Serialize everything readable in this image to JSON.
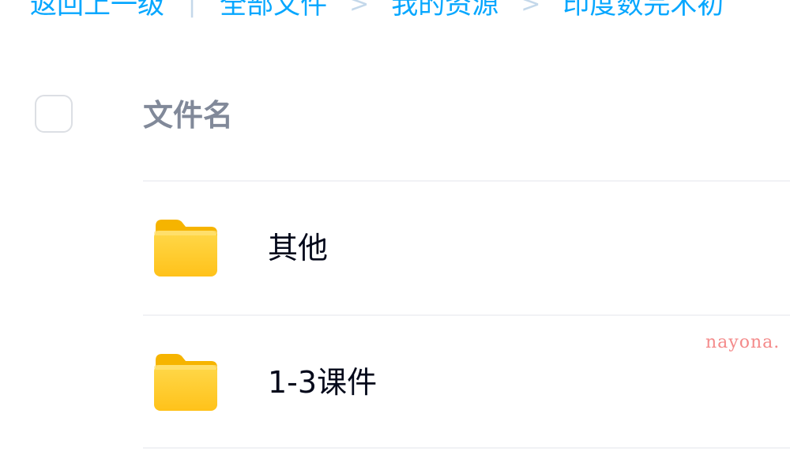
{
  "breadcrumb": {
    "back_label": "返回上一级",
    "divider": "|",
    "separator": ">",
    "items": [
      "全部文件",
      "我的资源",
      "印度数完术初"
    ]
  },
  "list_header": {
    "title": "文件名"
  },
  "files": [
    {
      "name": "其他",
      "type": "folder",
      "icon": "folder-icon"
    },
    {
      "name": "1-3课件",
      "type": "folder",
      "icon": "folder-icon"
    }
  ],
  "watermark": "nayona.",
  "colors": {
    "link": "#06a7ff",
    "separator": "#c4d8ea",
    "header_text": "#818999",
    "file_text": "#03081a",
    "folder_yellow": "#ffcc33",
    "watermark": "#f48a8a"
  }
}
